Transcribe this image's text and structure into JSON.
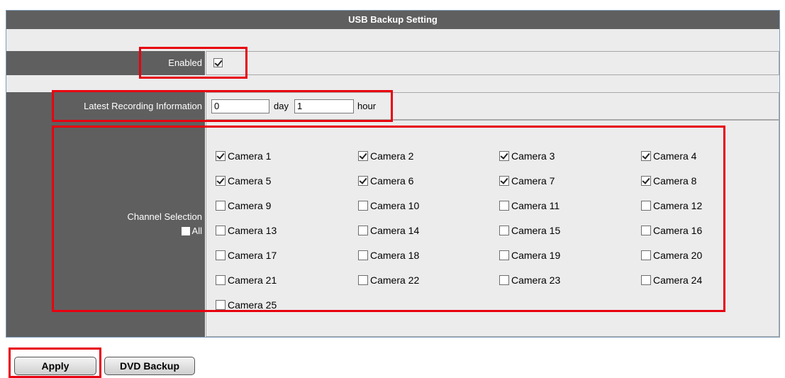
{
  "panel": {
    "title": "USB Backup Setting"
  },
  "enabled": {
    "label": "Enabled",
    "checked": true
  },
  "latest": {
    "label": "Latest Recording Information",
    "day_value": "0",
    "day_unit": "day",
    "hour_value": "1",
    "hour_unit": "hour"
  },
  "channel": {
    "label": "Channel Selection",
    "all_label": "All",
    "cameras": [
      {
        "label": "Camera 1",
        "checked": true
      },
      {
        "label": "Camera 2",
        "checked": true
      },
      {
        "label": "Camera 3",
        "checked": true
      },
      {
        "label": "Camera 4",
        "checked": true
      },
      {
        "label": "Camera 5",
        "checked": true
      },
      {
        "label": "Camera 6",
        "checked": true
      },
      {
        "label": "Camera 7",
        "checked": true
      },
      {
        "label": "Camera 8",
        "checked": true
      },
      {
        "label": "Camera 9",
        "checked": false
      },
      {
        "label": "Camera 10",
        "checked": false
      },
      {
        "label": "Camera 11",
        "checked": false
      },
      {
        "label": "Camera 12",
        "checked": false
      },
      {
        "label": "Camera 13",
        "checked": false
      },
      {
        "label": "Camera 14",
        "checked": false
      },
      {
        "label": "Camera 15",
        "checked": false
      },
      {
        "label": "Camera 16",
        "checked": false
      },
      {
        "label": "Camera 17",
        "checked": false
      },
      {
        "label": "Camera 18",
        "checked": false
      },
      {
        "label": "Camera 19",
        "checked": false
      },
      {
        "label": "Camera 20",
        "checked": false
      },
      {
        "label": "Camera 21",
        "checked": false
      },
      {
        "label": "Camera 22",
        "checked": false
      },
      {
        "label": "Camera 23",
        "checked": false
      },
      {
        "label": "Camera 24",
        "checked": false
      },
      {
        "label": "Camera 25",
        "checked": false
      }
    ]
  },
  "buttons": {
    "apply": "Apply",
    "dvd_backup": "DVD Backup"
  },
  "colors": {
    "highlight": "#e8000f",
    "header_bg": "#5f5f5f",
    "cell_bg": "#ececec"
  }
}
